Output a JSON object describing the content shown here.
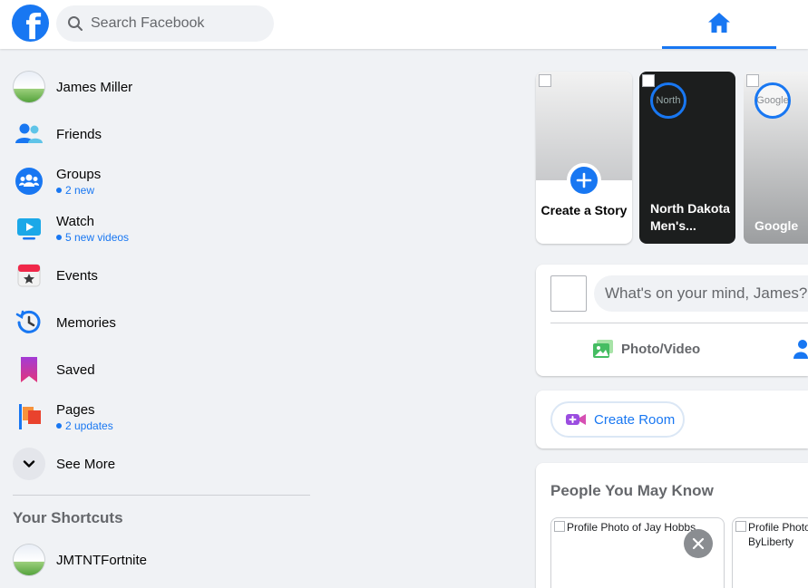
{
  "header": {
    "logo_letter": "f",
    "search_placeholder": "Search Facebook",
    "home_icon": "home-icon",
    "accent_color": "#1877f2"
  },
  "sidebar": {
    "items": [
      {
        "label": "James Miller",
        "icon": "avatar"
      },
      {
        "label": "Friends",
        "icon": "friends-icon"
      },
      {
        "label": "Groups",
        "sub": "2 new",
        "icon": "groups-icon"
      },
      {
        "label": "Watch",
        "sub": "5 new videos",
        "icon": "watch-icon"
      },
      {
        "label": "Events",
        "icon": "events-icon"
      },
      {
        "label": "Memories",
        "icon": "memories-icon"
      },
      {
        "label": "Saved",
        "icon": "saved-icon"
      },
      {
        "label": "Pages",
        "sub": "2 updates",
        "icon": "pages-icon"
      },
      {
        "label": "See More",
        "icon": "chevron-down-icon"
      }
    ],
    "shortcuts_title": "Your Shortcuts",
    "shortcuts": [
      {
        "label": "JMTNTFortnite",
        "icon": "avatar"
      }
    ]
  },
  "stories": {
    "create_label": "Create a Story",
    "items": [
      {
        "title": "North Dakota Men's...",
        "ring_alt": "North"
      },
      {
        "title": "Google",
        "ring_alt": "Google"
      }
    ]
  },
  "composer": {
    "placeholder": "What's on your mind, James?",
    "photo_video_label": "Photo/Video"
  },
  "room": {
    "create_room_label": "Create Room"
  },
  "people_you_may_know": {
    "title": "People You May Know",
    "cards": [
      {
        "alt": "Profile Photo of Jay Hobbs"
      },
      {
        "alt": "Profile Photo ByLiberty"
      }
    ]
  }
}
